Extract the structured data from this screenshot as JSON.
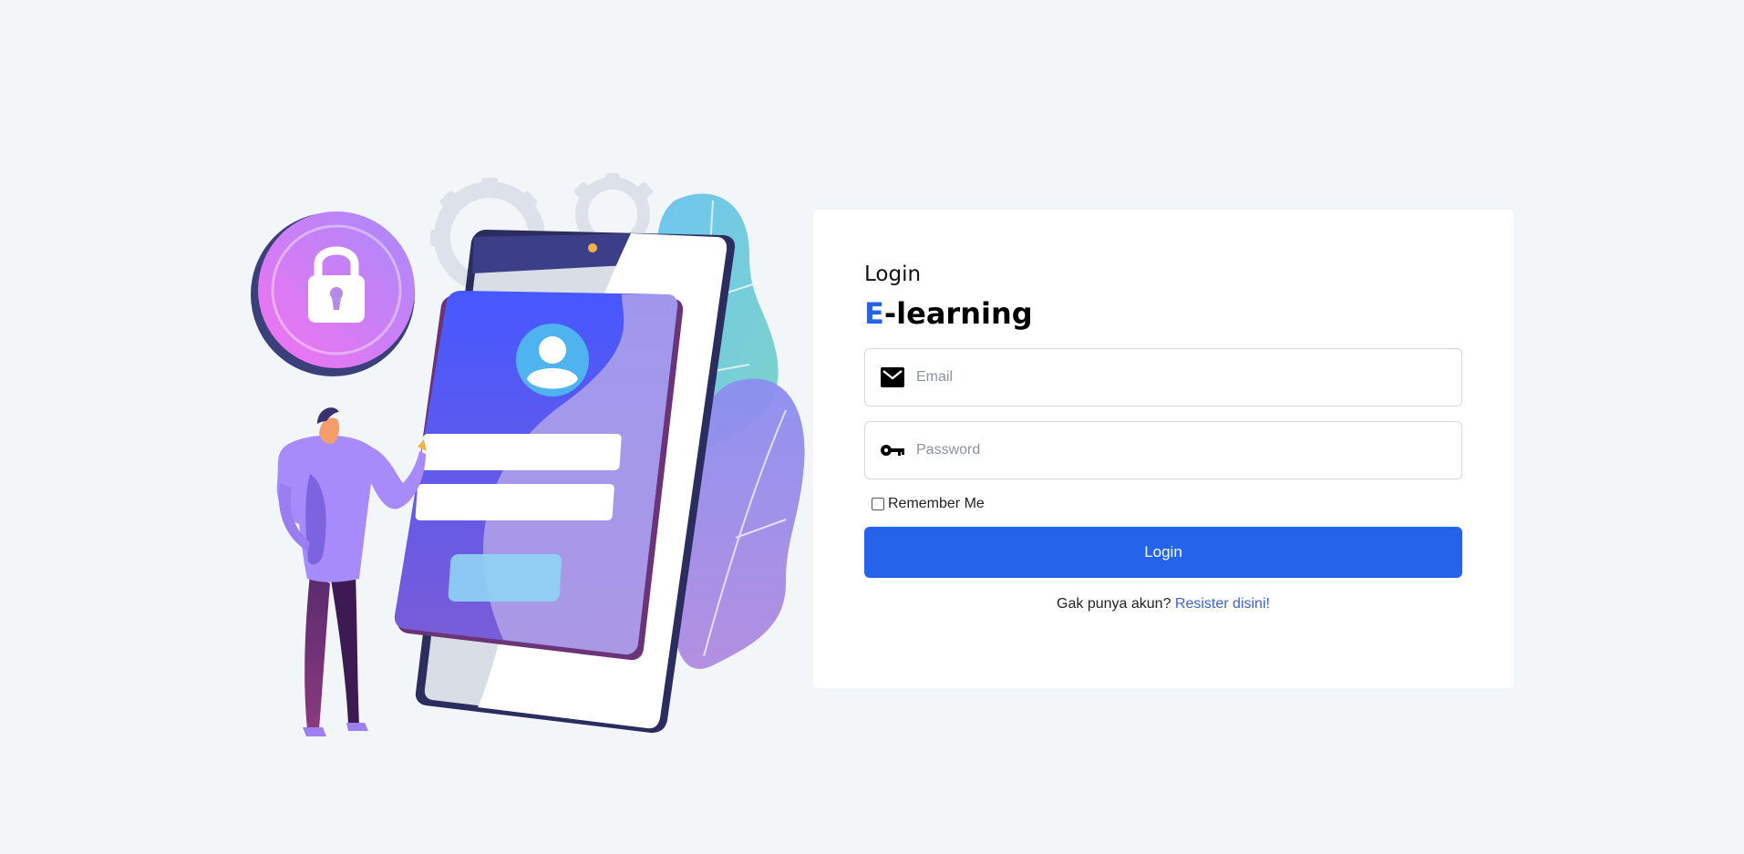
{
  "login_card": {
    "heading": "Login",
    "brand_accent": "E",
    "brand_rest": "-learning",
    "email_placeholder": "Email",
    "password_placeholder": "Password",
    "remember_label": "Remember Me",
    "remember_checked": false,
    "login_button": "Login",
    "register_prompt": "Gak punya akun?",
    "register_link": "Resister disini!"
  },
  "icons": {
    "email": "envelope-icon",
    "password": "key-icon"
  },
  "colors": {
    "accent": "#2563eb",
    "link": "#3b63d6",
    "background": "#f3f6f9"
  }
}
